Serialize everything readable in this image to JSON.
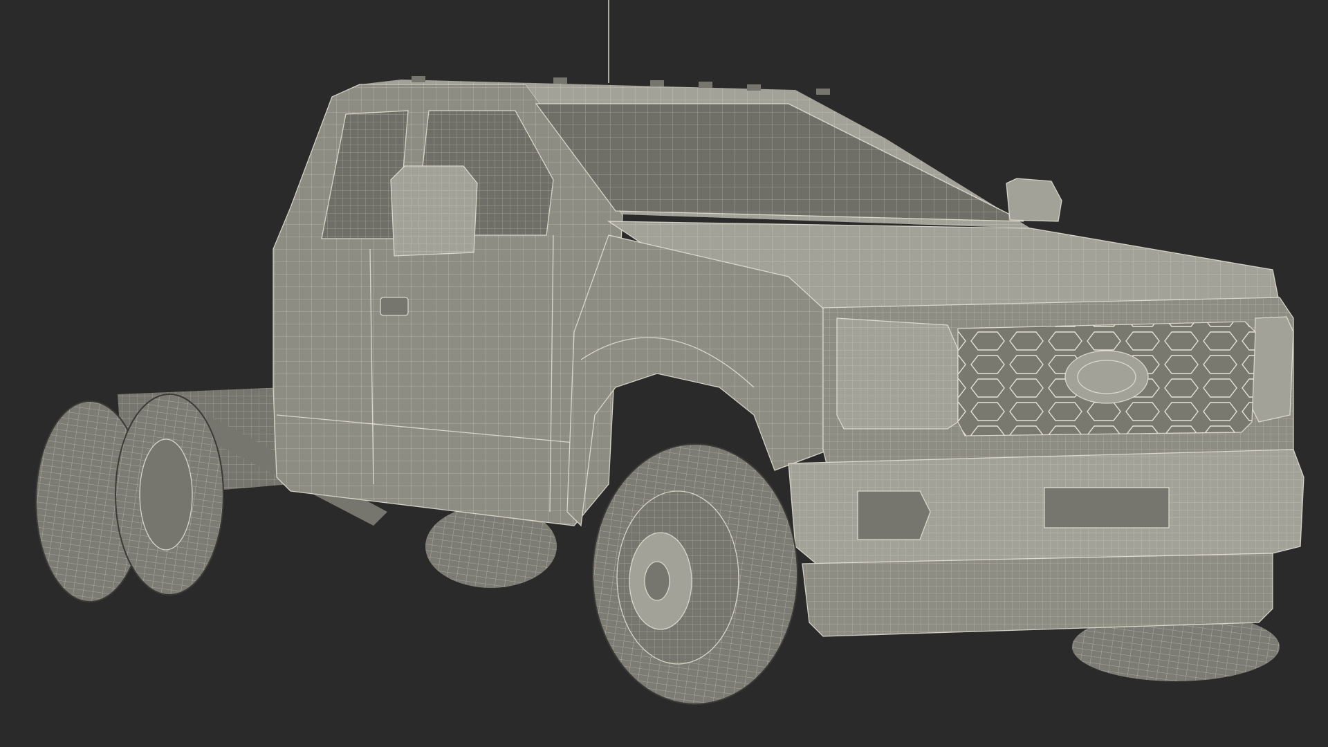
{
  "scene": {
    "subject": "wireframe-truck",
    "background_color": "#2a2a2a",
    "surface_color": "#8e8d84",
    "wire_color": "#e6e4d6"
  }
}
